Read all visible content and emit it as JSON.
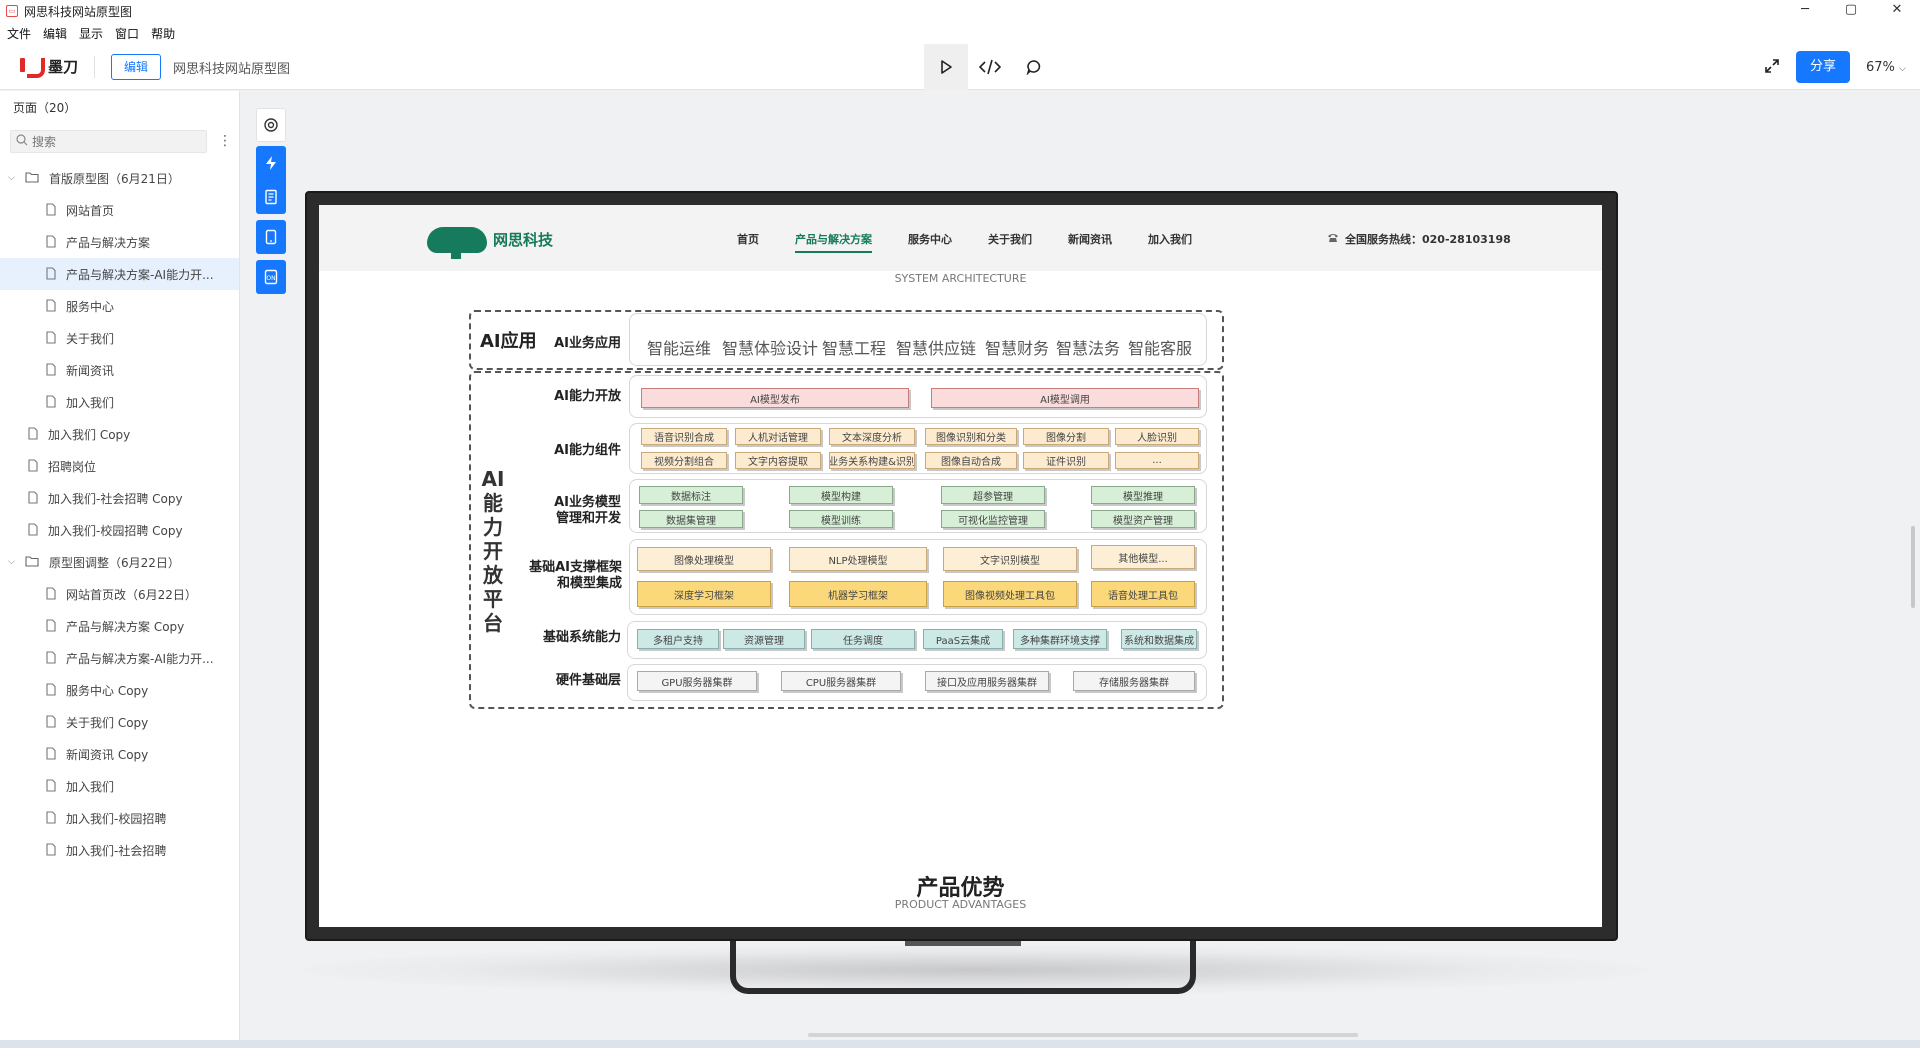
{
  "window": {
    "title": "网思科技网站原型图",
    "controls": [
      "─",
      "▢",
      "✕"
    ]
  },
  "menubar": [
    "文件",
    "编辑",
    "显示",
    "窗口",
    "帮助"
  ],
  "toolbar": {
    "brand": "墨刀",
    "edit_label": "编辑",
    "project_title": "网思科技网站原型图",
    "share_label": "分享",
    "zoom": "67%"
  },
  "sidebar": {
    "header": "页面（20）",
    "search_placeholder": "搜索",
    "items": [
      {
        "label": "首版原型图（6月21日）",
        "type": "folder",
        "level": 0
      },
      {
        "label": "网站首页",
        "type": "page",
        "level": 1
      },
      {
        "label": "产品与解决方案",
        "type": "page",
        "level": 1
      },
      {
        "label": "产品与解决方案-AI能力开...",
        "type": "page",
        "level": 1,
        "selected": true
      },
      {
        "label": "服务中心",
        "type": "page",
        "level": 1
      },
      {
        "label": "关于我们",
        "type": "page",
        "level": 1
      },
      {
        "label": "新闻资讯",
        "type": "page",
        "level": 1
      },
      {
        "label": "加入我们",
        "type": "page",
        "level": 1
      },
      {
        "label": "加入我们 Copy",
        "type": "page",
        "level": 0
      },
      {
        "label": "招聘岗位",
        "type": "page",
        "level": 0
      },
      {
        "label": "加入我们-社会招聘 Copy",
        "type": "page",
        "level": 0
      },
      {
        "label": "加入我们-校园招聘 Copy",
        "type": "page",
        "level": 0
      },
      {
        "label": "原型图调整（6月22日）",
        "type": "folder",
        "level": 0
      },
      {
        "label": "网站首页改（6月22日）",
        "type": "page",
        "level": 1
      },
      {
        "label": "产品与解决方案 Copy",
        "type": "page",
        "level": 1
      },
      {
        "label": "产品与解决方案-AI能力开...",
        "type": "page",
        "level": 1
      },
      {
        "label": "服务中心 Copy",
        "type": "page",
        "level": 1
      },
      {
        "label": "关于我们 Copy",
        "type": "page",
        "level": 1
      },
      {
        "label": "新闻资讯 Copy",
        "type": "page",
        "level": 1
      },
      {
        "label": "加入我们",
        "type": "page",
        "level": 1
      },
      {
        "label": "加入我们-校园招聘",
        "type": "page",
        "level": 1
      },
      {
        "label": "加入我们-社会招聘",
        "type": "page",
        "level": 1
      }
    ]
  },
  "site": {
    "logo_text": "网思科技",
    "menu": [
      "首页",
      "产品与解决方案",
      "服务中心",
      "关于我们",
      "新闻资讯",
      "加入我们"
    ],
    "hotline": "全国服务热线：020-28103198",
    "section_sub": "SYSTEM ARCHITECTURE",
    "advantages_title": "产品优势",
    "advantages_sub": "PRODUCT ADVANTAGES"
  },
  "arch": {
    "ai_app_label": "AI应用",
    "ai_business_app": "AI业务应用",
    "apps": [
      "智能运维",
      "智慧体验设计",
      "智慧工程",
      "智慧供应链",
      "智慧财务",
      "智慧法务",
      "智能客服"
    ],
    "platform_chars": [
      "AI",
      "能",
      "力",
      "开",
      "放",
      "平",
      "台"
    ],
    "rows": {
      "open": "AI能力开放",
      "components": "AI能力组件",
      "model_mgmt": "AI业务模型管理和开发",
      "framework": "基础AI支撑框架和模型集成",
      "system": "基础系统能力",
      "hardware": "硬件基础层"
    },
    "open_boxes": [
      "AI模型发布",
      "AI模型调用"
    ],
    "component_boxes": [
      "语音识别合成",
      "人机对话管理",
      "文本深度分析",
      "图像识别和分类",
      "图像分割",
      "人脸识别",
      "视频分割组合",
      "文字内容提取",
      "业务关系构建&识别",
      "图像自动合成",
      "证件识别",
      "..."
    ],
    "model_boxes": [
      "数据标注",
      "模型构建",
      "超参管理",
      "模型推理",
      "数据集管理",
      "模型训练",
      "可视化监控管理",
      "模型资产管理"
    ],
    "framework_boxes": [
      "图像处理模型",
      "NLP处理模型",
      "文字识别模型",
      "其他模型...",
      "深度学习框架",
      "机器学习框架",
      "图像视频处理工具包",
      "语音处理工具包"
    ],
    "system_boxes": [
      "多租户支持",
      "资源管理",
      "任务调度",
      "PaaS云集成",
      "多种集群环境支撑",
      "系统和数据集成"
    ],
    "hardware_boxes": [
      "GPU服务器集群",
      "CPU服务器集群",
      "接口及应用服务器集群",
      "存储服务器集群"
    ]
  },
  "colors": {
    "accent": "#1677ff",
    "brand_green": "#167a5c"
  }
}
